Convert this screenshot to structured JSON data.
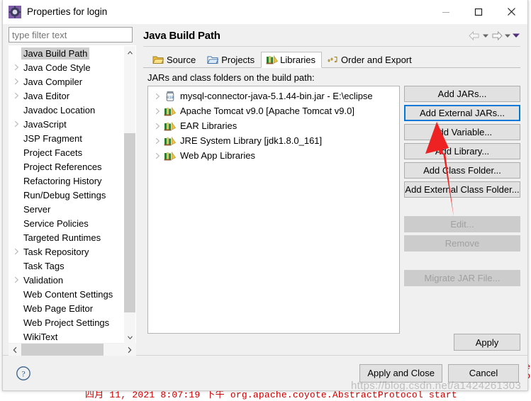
{
  "window": {
    "title": "Properties for login",
    "icon": "properties-gear-icon",
    "controls": {
      "minimize": "minimize-icon",
      "maximize": "maximize-icon",
      "close": "close-icon"
    }
  },
  "sidebar": {
    "filter": {
      "value": "",
      "placeholder": "type filter text"
    },
    "items": [
      {
        "label": "Java Build Path",
        "expandable": false,
        "selected": true
      },
      {
        "label": "Java Code Style",
        "expandable": true,
        "selected": false
      },
      {
        "label": "Java Compiler",
        "expandable": true,
        "selected": false
      },
      {
        "label": "Java Editor",
        "expandable": true,
        "selected": false
      },
      {
        "label": "Javadoc Location",
        "expandable": false,
        "selected": false
      },
      {
        "label": "JavaScript",
        "expandable": true,
        "selected": false
      },
      {
        "label": "JSP Fragment",
        "expandable": false,
        "selected": false
      },
      {
        "label": "Project Facets",
        "expandable": false,
        "selected": false
      },
      {
        "label": "Project References",
        "expandable": false,
        "selected": false
      },
      {
        "label": "Refactoring History",
        "expandable": false,
        "selected": false
      },
      {
        "label": "Run/Debug Settings",
        "expandable": false,
        "selected": false
      },
      {
        "label": "Server",
        "expandable": false,
        "selected": false
      },
      {
        "label": "Service Policies",
        "expandable": false,
        "selected": false
      },
      {
        "label": "Targeted Runtimes",
        "expandable": false,
        "selected": false
      },
      {
        "label": "Task Repository",
        "expandable": true,
        "selected": false
      },
      {
        "label": "Task Tags",
        "expandable": false,
        "selected": false
      },
      {
        "label": "Validation",
        "expandable": true,
        "selected": false
      },
      {
        "label": "Web Content Settings",
        "expandable": false,
        "selected": false
      },
      {
        "label": "Web Page Editor",
        "expandable": false,
        "selected": false
      },
      {
        "label": "Web Project Settings",
        "expandable": false,
        "selected": false
      },
      {
        "label": "WikiText",
        "expandable": false,
        "selected": false
      }
    ]
  },
  "main": {
    "page_title": "Java Build Path",
    "nav": {
      "back": "back-arrow-icon",
      "back_menu": "chevron-down-icon",
      "forward": "forward-arrow-icon",
      "forward_menu": "chevron-down-icon",
      "view_menu": "chevron-down-filled-icon"
    },
    "tabs": [
      {
        "label": "Source",
        "icon": "package-icon",
        "active": false
      },
      {
        "label": "Projects",
        "icon": "folder-open-icon",
        "active": false
      },
      {
        "label": "Libraries",
        "icon": "books-icon",
        "active": true
      },
      {
        "label": "Order and Export",
        "icon": "order-icon",
        "active": false
      }
    ],
    "pane_label": "JARs and class folders on the build path:",
    "libraries": [
      {
        "label": "mysql-connector-java-5.1.44-bin.jar - E:\\eclipse",
        "icon": "jar-icon"
      },
      {
        "label": "Apache Tomcat v9.0 [Apache Tomcat v9.0]",
        "icon": "books-icon"
      },
      {
        "label": "EAR Libraries",
        "icon": "books-icon"
      },
      {
        "label": "JRE System Library [jdk1.8.0_161]",
        "icon": "books-icon"
      },
      {
        "label": "Web App Libraries",
        "icon": "books-icon"
      }
    ],
    "buttons": [
      {
        "label": "Add JARs...",
        "state": "normal"
      },
      {
        "label": "Add External JARs...",
        "state": "focused"
      },
      {
        "label": "Add Variable...",
        "state": "normal"
      },
      {
        "label": "Add Library...",
        "state": "normal"
      },
      {
        "label": "Add Class Folder...",
        "state": "normal"
      },
      {
        "label": "Add External Class Folder...",
        "state": "normal"
      }
    ],
    "buttons2": [
      {
        "label": "Edit...",
        "state": "disabled"
      },
      {
        "label": "Remove",
        "state": "disabled"
      }
    ],
    "buttons3": [
      {
        "label": "Migrate JAR File...",
        "state": "disabled"
      }
    ],
    "apply_label": "Apply"
  },
  "footer": {
    "help": "help-icon",
    "apply_and_close": "Apply and Close",
    "cancel": "Cancel"
  },
  "background": {
    "console_line": "四月 11, 2021 8:07:19 下午 org.apache.coyote.AbstractProtocol start",
    "edge_text": "e\np"
  },
  "watermark": "https://blog.csdn.net/a1424261303",
  "colors": {
    "focus_blue": "#0078d7",
    "annotation_red": "#ee2222",
    "selection_grey": "#cdcdcd",
    "console_red": "#cc0000"
  }
}
